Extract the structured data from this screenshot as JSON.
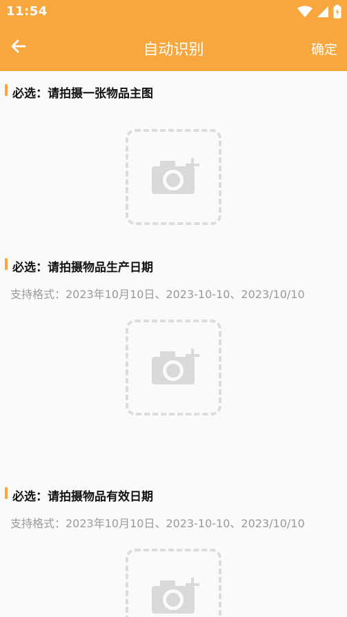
{
  "status_bar": {
    "time": "11:54",
    "icons": [
      "wifi-icon",
      "signal-icon",
      "battery-icon"
    ]
  },
  "app_bar": {
    "back_icon": "arrow-left-icon",
    "title": "自动识别",
    "confirm_label": "确定"
  },
  "sections": [
    {
      "title": "必选：请拍摄一张物品主图",
      "hint": "",
      "upload_icon": "camera-add-icon"
    },
    {
      "title": "必选：请拍摄物品生产日期",
      "hint": "支持格式：2023年10月10日、2023-10-10、2023/10/10",
      "upload_icon": "camera-add-icon"
    },
    {
      "title": "必选：请拍摄物品有效日期",
      "hint": "支持格式：2023年10月10日、2023-10-10、2023/10/10",
      "upload_icon": "camera-add-icon"
    }
  ],
  "colors": {
    "accent": "#f7a73e",
    "background": "#fafafa",
    "title_text": "#111111",
    "hint_text": "#9a9a9a",
    "placeholder_border": "#dcdcdc",
    "placeholder_icon": "#d9d9d9"
  }
}
